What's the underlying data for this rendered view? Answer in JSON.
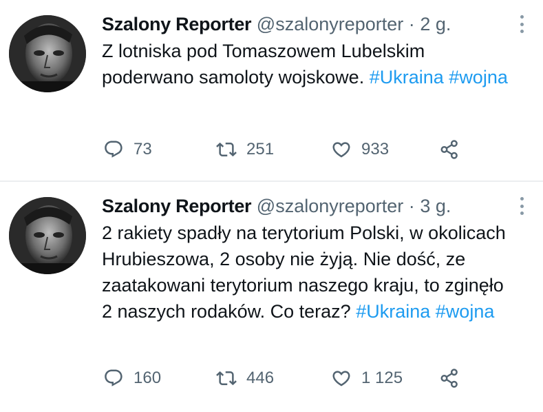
{
  "tweets": [
    {
      "name": "Szalony Reporter",
      "handle": "@szalonyreporter",
      "separator": "·",
      "time": "2 g.",
      "text_before_tags": "Z lotniska pod Tomaszowem Lubelskim poderwano samoloty wojskowe.",
      "tags": [
        "#Ukraina",
        "#wojna"
      ],
      "replies": "73",
      "retweets": "251",
      "likes": "933"
    },
    {
      "name": "Szalony Reporter",
      "handle": "@szalonyreporter",
      "separator": "·",
      "time": "3 g.",
      "text_before_tags": "2 rakiety spadły na terytorium Polski, w okolicach Hrubieszowa, 2 osoby nie żyją. Nie dość, ze zaatakowani terytorium naszego kraju, to zginęło 2 naszych rodaków. Co teraz?",
      "tags": [
        "#Ukraina",
        "#wojna"
      ],
      "replies": "160",
      "retweets": "446",
      "likes": "1 125"
    }
  ],
  "colors": {
    "text": "#0f1419",
    "secondary": "#536471",
    "link": "#1d9bf0",
    "divider": "#eceef0"
  },
  "icons": [
    "reply-icon",
    "retweet-icon",
    "like-icon",
    "share-icon",
    "more-icon"
  ]
}
